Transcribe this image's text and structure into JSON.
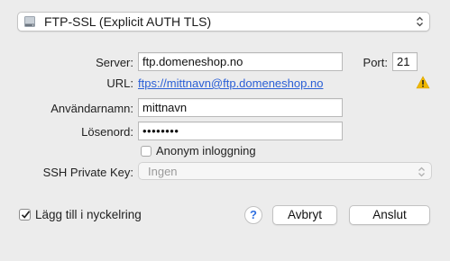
{
  "protocol": {
    "selected": "FTP-SSL (Explicit AUTH TLS)",
    "icon": "server-drive-icon"
  },
  "server": {
    "label": "Server:",
    "value": "ftp.domeneshop.no"
  },
  "port": {
    "label": "Port:",
    "value": "21"
  },
  "url": {
    "label": "URL:",
    "value": "ftps://mittnavn@ftp.domeneshop.no",
    "warning_icon": "warning-triangle-icon",
    "warning_color": "#f0b800"
  },
  "username": {
    "label": "Användarnamn:",
    "value": "mittnavn"
  },
  "password": {
    "label": "Lösenord:",
    "value": "••••••••"
  },
  "anonymous": {
    "label": "Anonym inloggning",
    "checked": false
  },
  "ssh_key": {
    "label": "SSH Private Key:",
    "value": "Ingen"
  },
  "keychain": {
    "label": "Lägg till i nyckelring",
    "checked": true
  },
  "buttons": {
    "help": "?",
    "cancel": "Avbryt",
    "connect": "Anslut"
  }
}
